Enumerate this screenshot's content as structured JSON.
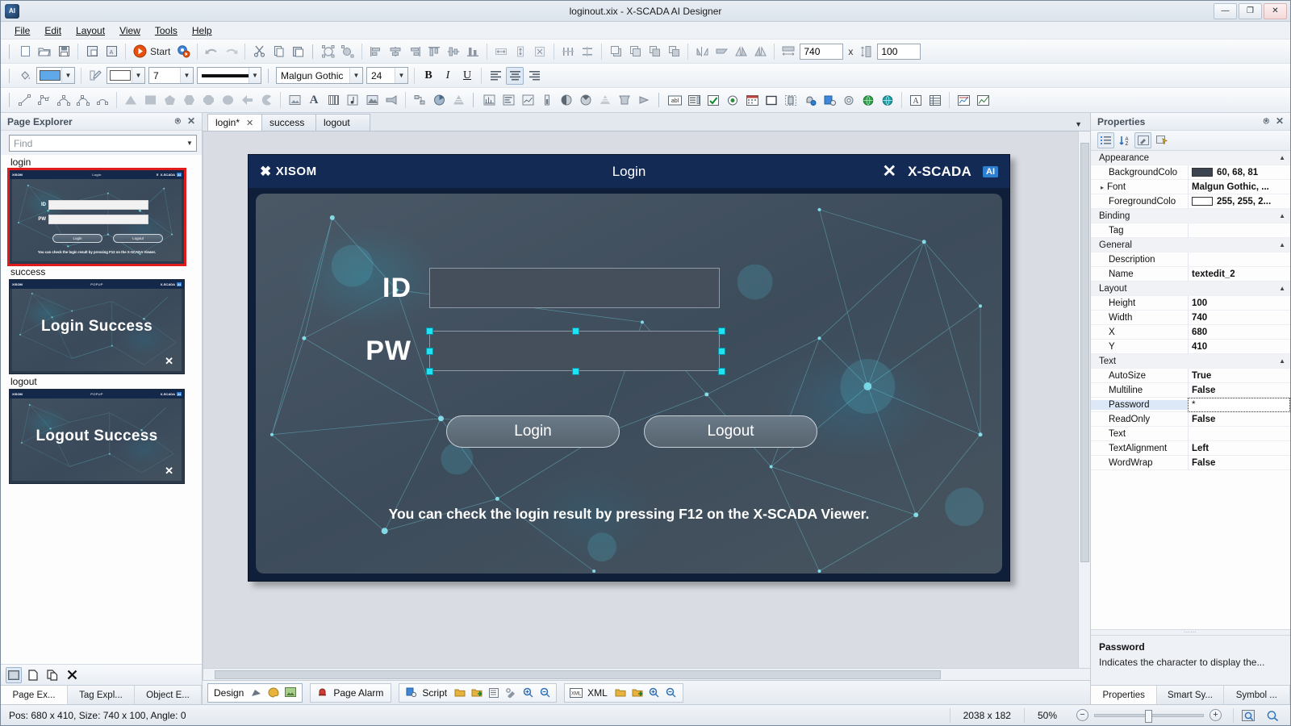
{
  "window": {
    "title": "loginout.xix - X-SCADA AI Designer",
    "app_icon": "app-logo-icon",
    "buttons": {
      "minimize": "—",
      "maximize": "❐",
      "close": "✕"
    }
  },
  "menubar": {
    "items": [
      "File",
      "Edit",
      "Layout",
      "View",
      "Tools",
      "Help"
    ]
  },
  "toolbar_main": {
    "icons": [
      "new-document-icon",
      "open-folder-icon",
      "save-icon",
      "save-as-icon",
      "save-all-icon"
    ],
    "start_label": "Start",
    "start_icon": "start-play-icon",
    "settings_icon": "gear-run-icon",
    "edit_icons": [
      "undo-icon",
      "redo-icon",
      "cut-icon",
      "copy-icon",
      "paste-icon"
    ],
    "transform_icons": [
      "rotate-selection-icon",
      "group-transform-icon"
    ],
    "align_icons": [
      "align-left-icon",
      "align-center-horizontal-icon",
      "align-right-icon",
      "align-top-icon",
      "align-middle-vertical-icon",
      "align-bottom-icon"
    ],
    "size_icons": [
      "make-same-width-icon",
      "make-same-height-icon",
      "make-same-size-icon"
    ],
    "space_icons": [
      "space-horizontally-icon",
      "space-vertically-icon"
    ],
    "order_icons": [
      "bring-to-front-icon",
      "send-to-back-icon",
      "group-icon"
    ],
    "flip_icons": [
      "flip-horizontal-icon",
      "flip-vertical-icon",
      "mirror-left-icon",
      "mirror-right-icon"
    ],
    "size_width_icon": "width-field-icon",
    "size_height_icon": "height-field-icon",
    "width_value": "740",
    "size_separator": "x",
    "height_value": "100"
  },
  "toolbar_format": {
    "fill_icon": "paint-bucket-icon",
    "fill_color_label": "",
    "pen_icon": "pen-icon",
    "line_color_label": "",
    "line_width_value": "7",
    "line_style_label": "",
    "font_family": "Malgun Gothic",
    "font_size": "24",
    "bold": "B",
    "italic": "I",
    "underline": "U",
    "align_left_icon": "text-align-left-icon",
    "align_center_icon": "text-align-center-icon",
    "align_right_icon": "text-align-right-icon"
  },
  "toolbar_shapes": {
    "draw_icons": [
      "line-icon",
      "polyline-icon",
      "curve-icon",
      "bezier-icon",
      "arc-icon"
    ],
    "shape_icons": [
      "triangle-icon",
      "rectangle-icon",
      "pentagon-icon",
      "hexagon-icon",
      "octagon-icon",
      "ellipse-icon",
      "arrow-icon",
      "pie-icon"
    ],
    "media_icons": [
      "image-icon",
      "text-icon",
      "barcode-icon",
      "sound-icon",
      "video-icon",
      "camera-icon"
    ],
    "misc_icons": [
      "flowchart-icon",
      "pie-chart-icon",
      "cone-icon"
    ],
    "gauge_icons": [
      "bar-graph-icon",
      "level-bar-icon",
      "trend-icon",
      "thermometer-icon",
      "meter-icon",
      "dial-icon",
      "funnel-icon",
      "tank-icon",
      "valve-icon"
    ],
    "control_icons": [
      "textbox-icon",
      "listbox-icon",
      "checkbox-icon",
      "radio-icon",
      "calendar-icon",
      "button-icon",
      "toggle-icon",
      "alarm-icon",
      "script-icon",
      "settings-icon",
      "globe-icon",
      "web-icon",
      "label-icon",
      "grid-icon",
      "chart-icon",
      "line-chart-icon"
    ]
  },
  "page_explorer": {
    "title": "Page Explorer",
    "pin_icon": "pin-icon",
    "close_icon": "close-icon",
    "find_placeholder": "Find",
    "pages": [
      {
        "name": "login",
        "selected": true,
        "kind": "login",
        "bar_brand": "XISOM",
        "bar_center": "Login",
        "bar_right": "X-SCADA",
        "bar_close": "✕",
        "id_label": "ID",
        "pw_label": "PW",
        "login_button": "Login",
        "logout_button": "Logout",
        "note": "You can check the login result by pressing F12 on the X-SCADA Viewer."
      },
      {
        "name": "success",
        "selected": false,
        "kind": "popup",
        "bar_brand": "XISOM",
        "bar_center": "POPUP",
        "bar_right": "X-SCADA",
        "big_text": "Login Success",
        "close_glyph": "✕"
      },
      {
        "name": "logout",
        "selected": false,
        "kind": "popup",
        "bar_brand": "XISOM",
        "bar_center": "POPUP",
        "bar_right": "X-SCADA",
        "big_text": "Logout Success",
        "close_glyph": "✕"
      }
    ],
    "footer_icons": [
      "thumbnail-view-icon",
      "new-page-icon",
      "duplicate-page-icon",
      "delete-page-icon"
    ],
    "dock_tabs": [
      {
        "label": "Page Ex...",
        "active": true
      },
      {
        "label": "Tag Expl...",
        "active": false
      },
      {
        "label": "Object E...",
        "active": false
      }
    ]
  },
  "document_tabs": [
    {
      "label": "login*",
      "active": true,
      "close": "✕"
    },
    {
      "label": "success",
      "active": false,
      "close": ""
    },
    {
      "label": "logout",
      "active": false,
      "close": ""
    }
  ],
  "canvas": {
    "login_page": {
      "brand": "XISOM",
      "brand_mark": "✖",
      "title": "Login",
      "close_glyph": "✕",
      "scada_label": "X-SCADA",
      "ai_badge": "AI",
      "id_label": "ID",
      "pw_label": "PW",
      "login_button": "Login",
      "logout_button": "Logout",
      "note": "You can check the login result by pressing F12 on the X-SCADA Viewer.",
      "selected_element": "pw-textbox"
    }
  },
  "bottom_toolbar": {
    "groups": [
      {
        "label": "Design",
        "active": true,
        "icons": [
          "design-tool-icon",
          "palette-icon",
          "image-icon"
        ]
      },
      {
        "label": "Page Alarm",
        "active": false,
        "icons": [
          "alarm-bell-icon"
        ]
      },
      {
        "label": "Script",
        "active": false,
        "icons": [
          "script-icon",
          "open-folder-icon",
          "export-icon",
          "list-icon",
          "wrench-icon",
          "zoom-in-icon",
          "zoom-out-icon"
        ]
      },
      {
        "label": "XML",
        "active": false,
        "icons": [
          "xml-icon",
          "open-folder-icon",
          "export-icon",
          "zoom-in-icon",
          "zoom-out-icon"
        ]
      }
    ]
  },
  "properties": {
    "title": "Properties",
    "pin_icon": "pin-icon",
    "close_icon": "close-icon",
    "toolbar_icons": [
      "categorized-icon",
      "alphabetical-icon",
      "property-pages-icon",
      "events-icon"
    ],
    "rows": [
      {
        "type": "category",
        "name": "Appearance"
      },
      {
        "type": "prop",
        "name": "BackgroundColo",
        "value": "60, 68, 81",
        "swatch": "#3c4451"
      },
      {
        "type": "prop",
        "name": "Font",
        "value": "Malgun Gothic, ...",
        "expandable": true
      },
      {
        "type": "prop",
        "name": "ForegroundColo",
        "value": "255, 255, 2...",
        "swatch": "#ffffff"
      },
      {
        "type": "category",
        "name": "Binding"
      },
      {
        "type": "prop",
        "name": "Tag",
        "value": ""
      },
      {
        "type": "category",
        "name": "General"
      },
      {
        "type": "prop",
        "name": "Description",
        "value": ""
      },
      {
        "type": "prop",
        "name": "Name",
        "value": "textedit_2"
      },
      {
        "type": "category",
        "name": "Layout"
      },
      {
        "type": "prop",
        "name": "Height",
        "value": "100"
      },
      {
        "type": "prop",
        "name": "Width",
        "value": "740"
      },
      {
        "type": "prop",
        "name": "X",
        "value": "680"
      },
      {
        "type": "prop",
        "name": "Y",
        "value": "410"
      },
      {
        "type": "category",
        "name": "Text"
      },
      {
        "type": "prop",
        "name": "AutoSize",
        "value": "True"
      },
      {
        "type": "prop",
        "name": "Multiline",
        "value": "False"
      },
      {
        "type": "prop",
        "name": "Password",
        "value": "*",
        "selected": true
      },
      {
        "type": "prop",
        "name": "ReadOnly",
        "value": "False"
      },
      {
        "type": "prop",
        "name": "Text",
        "value": ""
      },
      {
        "type": "prop",
        "name": "TextAlignment",
        "value": "Left"
      },
      {
        "type": "prop",
        "name": "WordWrap",
        "value": "False"
      }
    ],
    "description": {
      "title": "Password",
      "text": "Indicates the character to display the..."
    },
    "dock_tabs": [
      {
        "label": "Properties",
        "active": true
      },
      {
        "label": "Smart Sy...",
        "active": false
      },
      {
        "label": "Symbol ...",
        "active": false
      }
    ]
  },
  "statusbar": {
    "position_text": "Pos: 680 x 410, Size: 740 x 100, Angle: 0",
    "canvas_size": "2038 x 182",
    "zoom": "50%",
    "zoom_out_icon": "zoom-out-icon",
    "zoom_in_icon": "zoom-in-icon",
    "fit_icon": "fit-page-icon",
    "actual_icon": "actual-size-icon"
  },
  "colors": {
    "accent_blue": "#2f7fd0",
    "selection_cyan": "#1ee3f5",
    "page_header_navy": "#132a55",
    "thumb_selection_red": "#e01b1b"
  }
}
